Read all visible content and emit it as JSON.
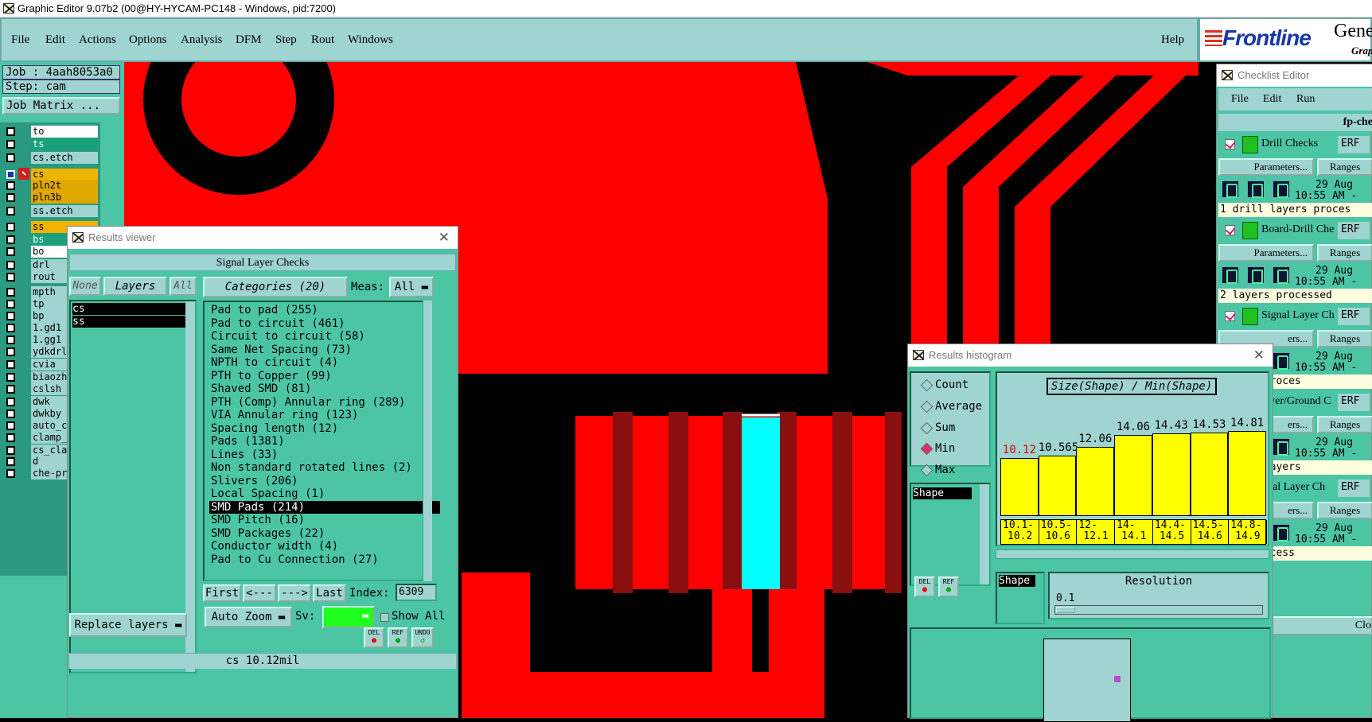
{
  "window": {
    "title": "Graphic Editor 9.07b2 (00@HY-HYCAM-PC148 - Windows, pid:7200)"
  },
  "menu": {
    "items": [
      "File",
      "Edit",
      "Actions",
      "Options",
      "Analysis",
      "DFM",
      "Step",
      "Rout",
      "Windows"
    ],
    "help": "Help"
  },
  "logo": {
    "brand": "Frontline",
    "suffix": "Gene",
    "sub": "Grap"
  },
  "job": {
    "job_label": "Job : 4aah8053a0",
    "step_label": "Step: cam",
    "matrix_button": "Job Matrix ..."
  },
  "layers": [
    {
      "name": "to",
      "color": "#ffffff"
    },
    {
      "name": "ts",
      "color": "#1aa07a"
    },
    {
      "name": "cs.etch",
      "color": "#9fd4d0"
    },
    {
      "name": "cs",
      "color": "#f0b400"
    },
    {
      "name": "pln2t",
      "color": "#e0a800"
    },
    {
      "name": "pln3b",
      "color": "#e0a800"
    },
    {
      "name": "ss.etch",
      "color": "#9fd4d0"
    },
    {
      "name": "ss",
      "color": "#f0b400"
    },
    {
      "name": "bs",
      "color": "#1aa07a"
    },
    {
      "name": "bo",
      "color": "#ffffff"
    },
    {
      "name": "drl",
      "color": "#9fd4d0"
    },
    {
      "name": "rout",
      "color": "#9fd4d0"
    },
    {
      "name": "mpth",
      "color": "#9fd4d0"
    },
    {
      "name": "tp",
      "color": "#9fd4d0"
    },
    {
      "name": "bp",
      "color": "#9fd4d0"
    },
    {
      "name": "1.gd1",
      "color": "#9fd4d0"
    },
    {
      "name": "1.gg1",
      "color": "#9fd4d0"
    },
    {
      "name": "ydkdrl",
      "color": "#9fd4d0"
    },
    {
      "name": "cvia",
      "color": "#9fd4d0"
    },
    {
      "name": "biaozh",
      "color": "#9fd4d0"
    },
    {
      "name": "cslsh",
      "color": "#9fd4d0"
    },
    {
      "name": "dwk",
      "color": "#9fd4d0"
    },
    {
      "name": "dwkby",
      "color": "#9fd4d0"
    },
    {
      "name": "auto_c",
      "color": "#9fd4d0"
    },
    {
      "name": "clamp_",
      "color": "#9fd4d0"
    },
    {
      "name": "cs_cla",
      "color": "#9fd4d0"
    },
    {
      "name": "d",
      "color": "#9fd4d0"
    },
    {
      "name": "che-pr",
      "color": "#9fd4d0"
    }
  ],
  "results_viewer": {
    "title": "Results viewer",
    "header": "Signal Layer Checks",
    "none_btn": "None",
    "layers_btn": "Layers",
    "all_btn": "All",
    "layer_list": [
      "cs",
      "ss"
    ],
    "categories_btn": "Categories (20)",
    "meas_label": "Meas:",
    "meas_value": "All",
    "categories": [
      "Pad to pad (255)",
      "Pad to circuit (461)",
      "Circuit to circuit (58)",
      "Same Net Spacing (73)",
      "NPTH to circuit (4)",
      "PTH to Copper (99)",
      "Shaved SMD (81)",
      "PTH (Comp) Annular ring (289)",
      "VIA Annular ring (123)",
      "Spacing length (12)",
      "Pads (1381)",
      "Lines (33)",
      "Non standard rotated lines (2)",
      "Slivers (206)",
      "Local Spacing (1)",
      "SMD Pads (214)",
      "SMD Pitch (16)",
      "SMD Packages (22)",
      "Conductor width (4)",
      "Pad to Cu Connection (27)"
    ],
    "selected_category": "SMD Pads (214)",
    "first_btn": "First",
    "prev_btn": "<---",
    "next_btn": "--->",
    "last_btn": "Last",
    "index_label": "Index:",
    "index_value": "6309",
    "auto_zoom": "Auto Zoom",
    "sv_label": "Sv:",
    "show_all": "Show All",
    "replace_layers": "Replace layers",
    "status": "cs 10.12mil",
    "del": "DEL",
    "ref": "REF",
    "undo": "UNDO"
  },
  "histogram": {
    "title": "Results histogram",
    "modes": [
      "Count",
      "Average",
      "Sum",
      "Min",
      "Max"
    ],
    "selected_mode": "Min",
    "list_item": "Shape",
    "chart_title": "Size(Shape) / Min(Shape)",
    "shape_label": "Shape",
    "resolution_label": "Resolution",
    "resolution_value": "0.1",
    "del": "DEL",
    "ref": "REF"
  },
  "chart_data": {
    "type": "bar",
    "title": "Size(Shape) / Min(Shape)",
    "categories": [
      "10.1-10.2",
      "10.5-10.6",
      "12-12.1",
      "14-14.1",
      "14.4-14.5",
      "14.5-14.6",
      "14.8-14.9"
    ],
    "category_labels": [
      [
        "10.1-",
        "10.2"
      ],
      [
        "10.5-",
        "10.6"
      ],
      [
        "12-",
        "12.1"
      ],
      [
        "14-",
        "14.1"
      ],
      [
        "14.4-",
        "14.5"
      ],
      [
        "14.5-",
        "14.6"
      ],
      [
        "14.8-",
        "14.9"
      ]
    ],
    "values": [
      10.12,
      10.565,
      12.06,
      14.06,
      14.43,
      14.53,
      14.81
    ],
    "value_labels": [
      "10.12",
      "10.565",
      "12.06",
      "14.06",
      "14.43",
      "14.53",
      "14.81"
    ],
    "ylim": [
      0,
      17
    ],
    "highlight_color": "#e00000",
    "bar_color": "#ffff00"
  },
  "checklist": {
    "title": "Checklist Editor",
    "menu": [
      "File",
      "Edit",
      "Run"
    ],
    "name": "fp-che",
    "close_btn": "Clo",
    "items": [
      {
        "name": "Drill Checks",
        "erf": "ERF",
        "params": "Parameters...",
        "ranges": "Ranges",
        "date": "29 Aug",
        "time": "10:55 AM -",
        "status": "1 drill layers proces"
      },
      {
        "name": "Board-Drill Che",
        "erf": "ERF",
        "params": "Parameters...",
        "ranges": "Ranges",
        "date": "29 Aug",
        "time": "10:55 AM -",
        "status": "2 layers processed"
      },
      {
        "name": "Signal Layer Ch",
        "erf": "ERF",
        "params": "ers...",
        "ranges": "Ranges",
        "date": "29 Aug",
        "time": "10:55 AM -",
        "status": "s were proces"
      },
      {
        "name": "ower/Ground C",
        "erf": "ERF",
        "params": "ers...",
        "ranges": "Ranges",
        "date": "29 Aug",
        "time": "10:55 AM -",
        "status": "ground layers"
      },
      {
        "name": "gnal Layer Ch",
        "erf": "ERF",
        "params": "ers...",
        "ranges": "Ranges",
        "date": "29 Aug",
        "time": "10:55 AM -",
        "status": "were process"
      }
    ]
  },
  "colors": {
    "copper": "#ff0000",
    "background": "#000000",
    "selected_pad": "#00ffff",
    "panel": "#4cc5a5",
    "panel_light": "#9fd4d0"
  }
}
